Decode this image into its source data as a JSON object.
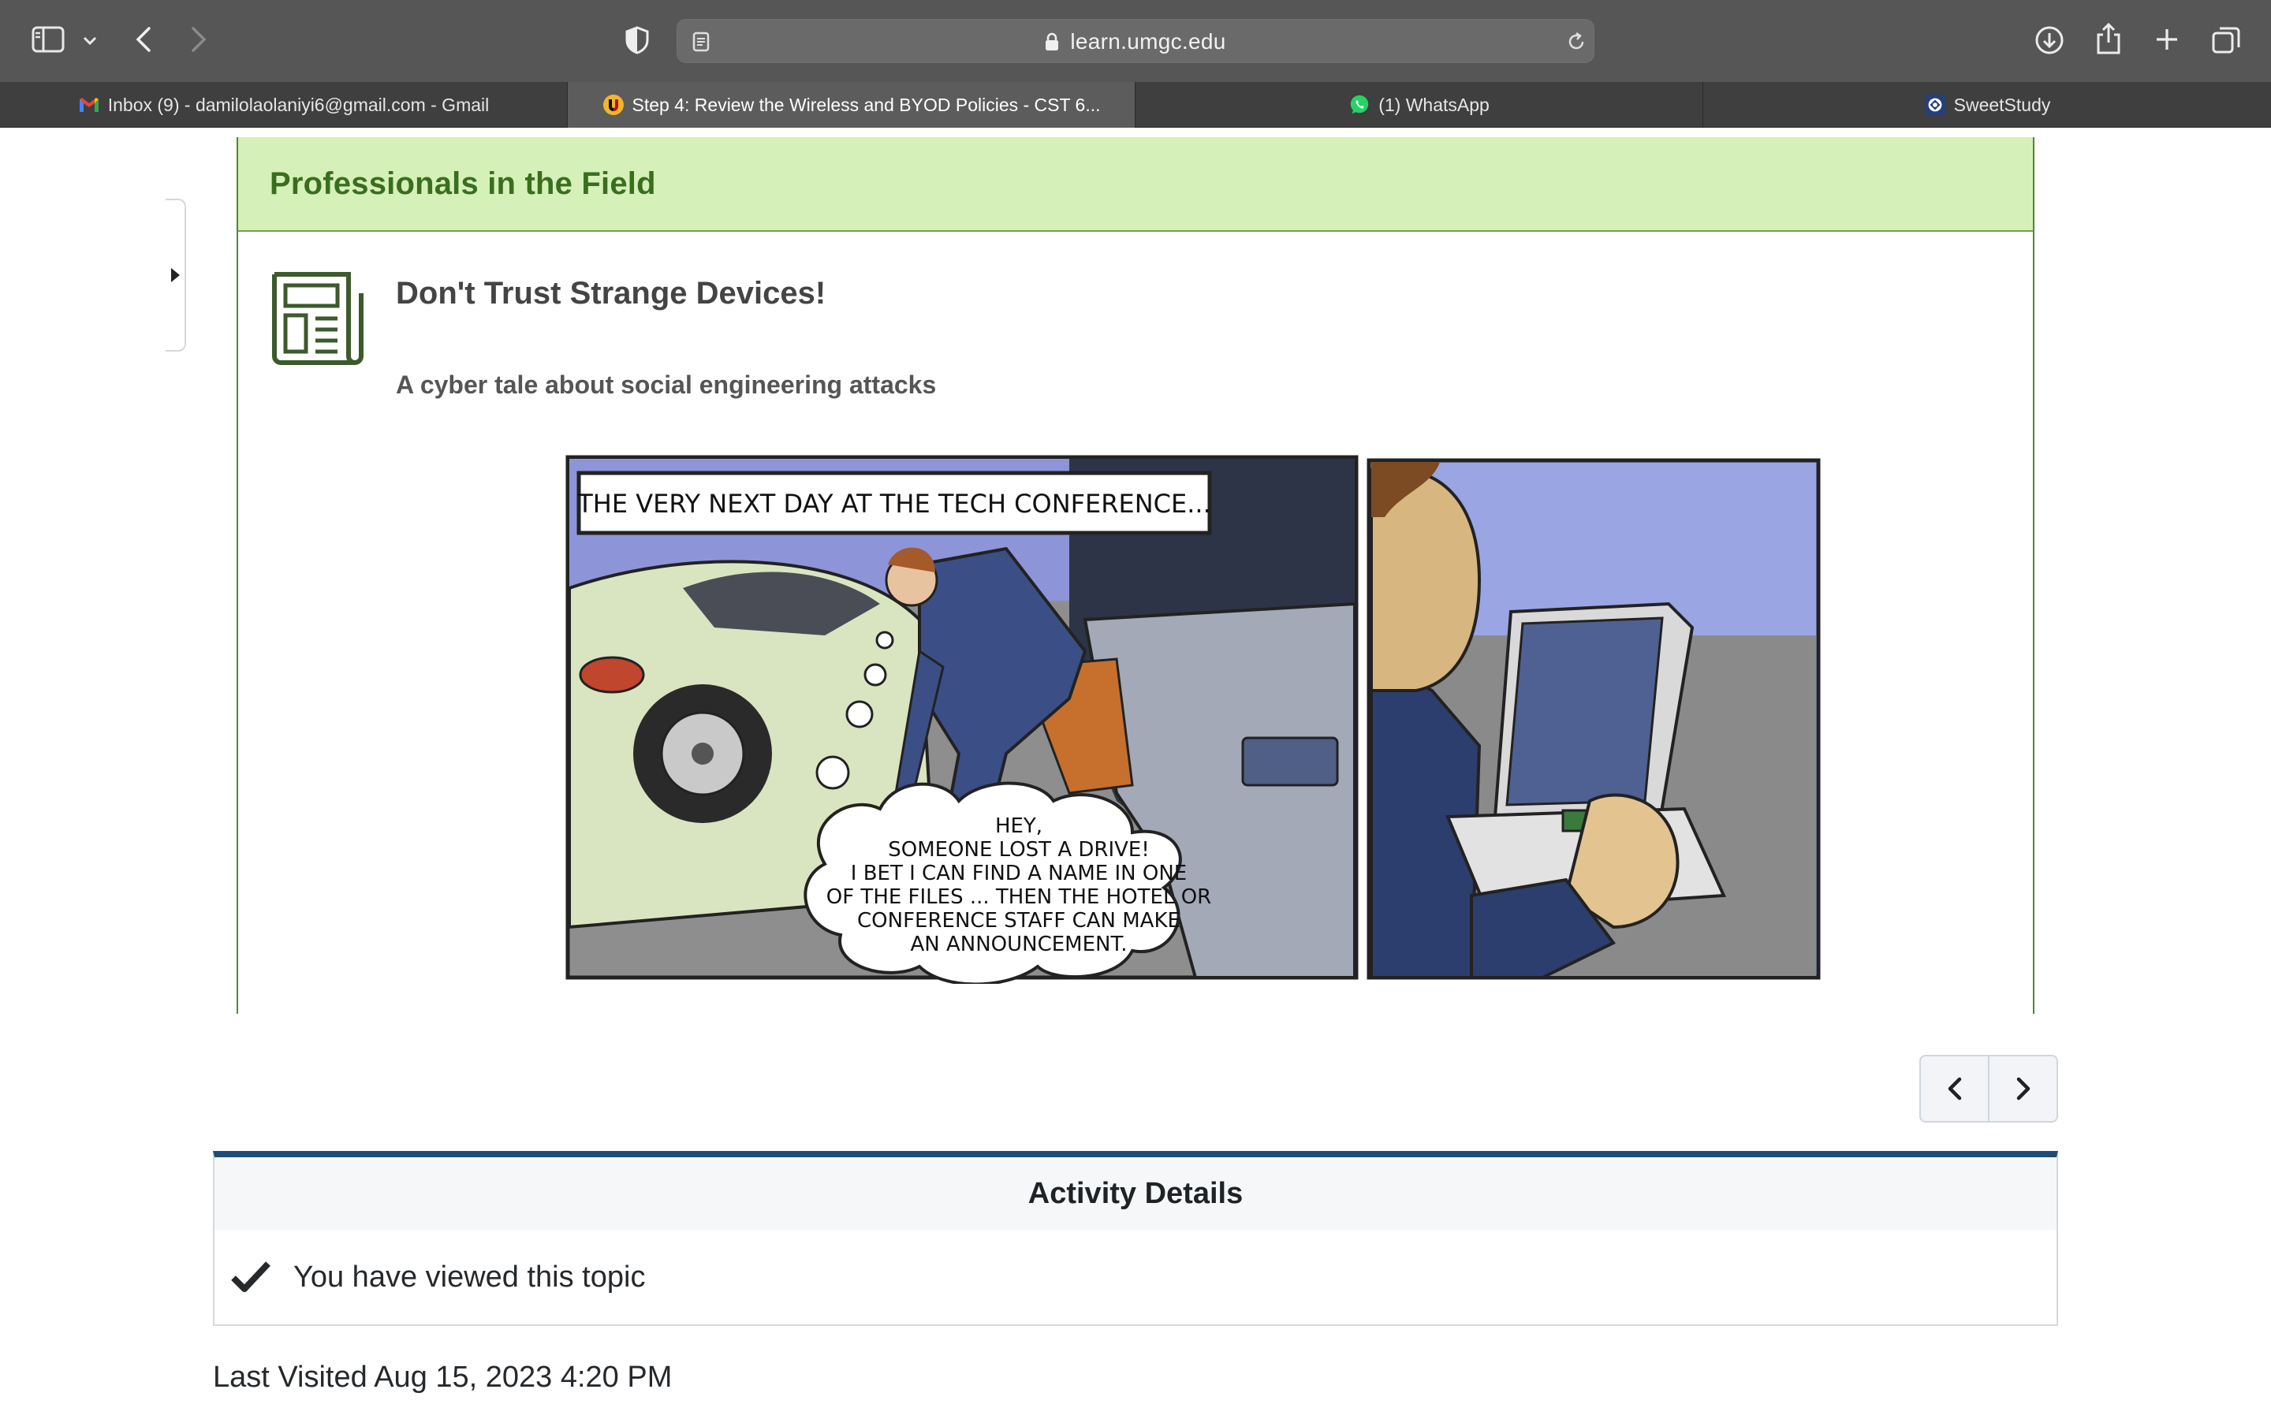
{
  "browser": {
    "url": "learn.umgc.edu",
    "tabs": [
      {
        "label": "Inbox (9) - damilolaolaniyi6@gmail.com - Gmail",
        "icon": "gmail-icon",
        "active": false
      },
      {
        "label": "Step 4: Review the Wireless and BYOD Policies - CST 6...",
        "icon": "umgc-icon",
        "active": true
      },
      {
        "label": "(1) WhatsApp",
        "icon": "whatsapp-icon",
        "active": false
      },
      {
        "label": "SweetStudy",
        "icon": "sweetstudy-icon",
        "active": false
      }
    ]
  },
  "content": {
    "section_title": "Professionals in the Field",
    "item_title": "Don't Trust Strange Devices!",
    "item_subtitle": "A cyber tale about social engineering attacks",
    "comic": {
      "caption": "THE VERY NEXT DAY AT THE TECH CONFERENCE...",
      "thought_lines": [
        "HEY,",
        "SOMEONE LOST A DRIVE!",
        "I BET I CAN FIND A NAME IN ONE",
        "OF THE FILES ... THEN THE HOTEL OR",
        "CONFERENCE STAFF CAN MAKE",
        "AN ANNOUNCEMENT."
      ]
    }
  },
  "activity": {
    "heading": "Activity Details",
    "status": "You have viewed this topic"
  },
  "last_visited": "Last Visited Aug 15, 2023 4:20 PM",
  "colors": {
    "section_header_bg": "#d5f0b8",
    "section_header_text": "#3a6e1f",
    "card_border": "#4d8a2e",
    "activity_top_border": "#1e4d7a"
  }
}
